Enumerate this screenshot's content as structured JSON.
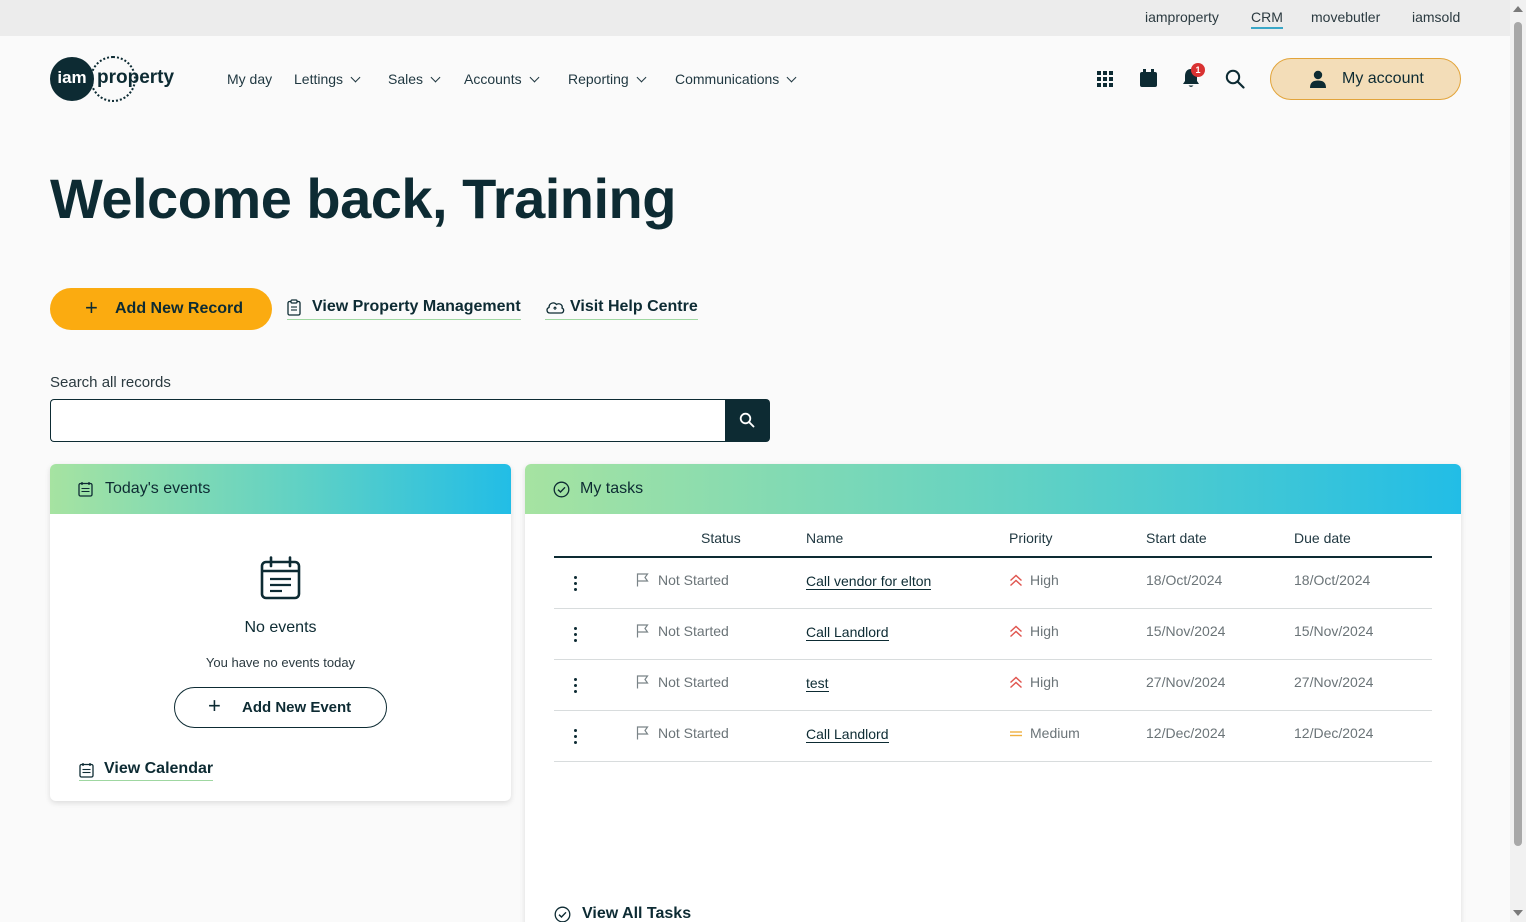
{
  "topbar": {
    "links": [
      "iamproperty",
      "CRM",
      "movebutler",
      "iamsold"
    ],
    "active": "CRM"
  },
  "brand": {
    "logo_circle": "iam",
    "logo_word": "property"
  },
  "nav": {
    "items": [
      "My day",
      "Lettings",
      "Sales",
      "Accounts",
      "Reporting",
      "Communications"
    ]
  },
  "header_icons": {
    "notifications_count": "1",
    "account_label": "My account"
  },
  "welcome": {
    "title": "Welcome back, Training"
  },
  "actions": {
    "add_record": "Add New Record",
    "view_property_management": "View Property Management",
    "help_centre": "Visit Help Centre"
  },
  "search": {
    "label": "Search all records",
    "value": ""
  },
  "events": {
    "title": "Today's events",
    "empty_title": "No events",
    "empty_sub": "You have no events today",
    "add_event": "Add New Event",
    "view_calendar": "View Calendar"
  },
  "tasks": {
    "title": "My tasks",
    "columns": [
      "Status",
      "Name",
      "Priority",
      "Start date",
      "Due date"
    ],
    "rows": [
      {
        "status": "Not Started",
        "name": "Call vendor for elton",
        "priority": "High",
        "start": "18/Oct/2024",
        "due": "18/Oct/2024"
      },
      {
        "status": "Not Started",
        "name": "Call Landlord",
        "priority": "High",
        "start": "15/Nov/2024",
        "due": "15/Nov/2024"
      },
      {
        "status": "Not Started",
        "name": "test",
        "priority": "High",
        "start": "27/Nov/2024",
        "due": "27/Nov/2024"
      },
      {
        "status": "Not Started",
        "name": "Call Landlord",
        "priority": "Medium",
        "start": "12/Dec/2024",
        "due": "12/Dec/2024"
      }
    ],
    "view_all": "View All Tasks"
  },
  "colors": {
    "brand_dark": "#0d2b33",
    "accent_orange": "#fbab10",
    "priority_high": "#e0554f",
    "priority_medium": "#f0b040"
  }
}
